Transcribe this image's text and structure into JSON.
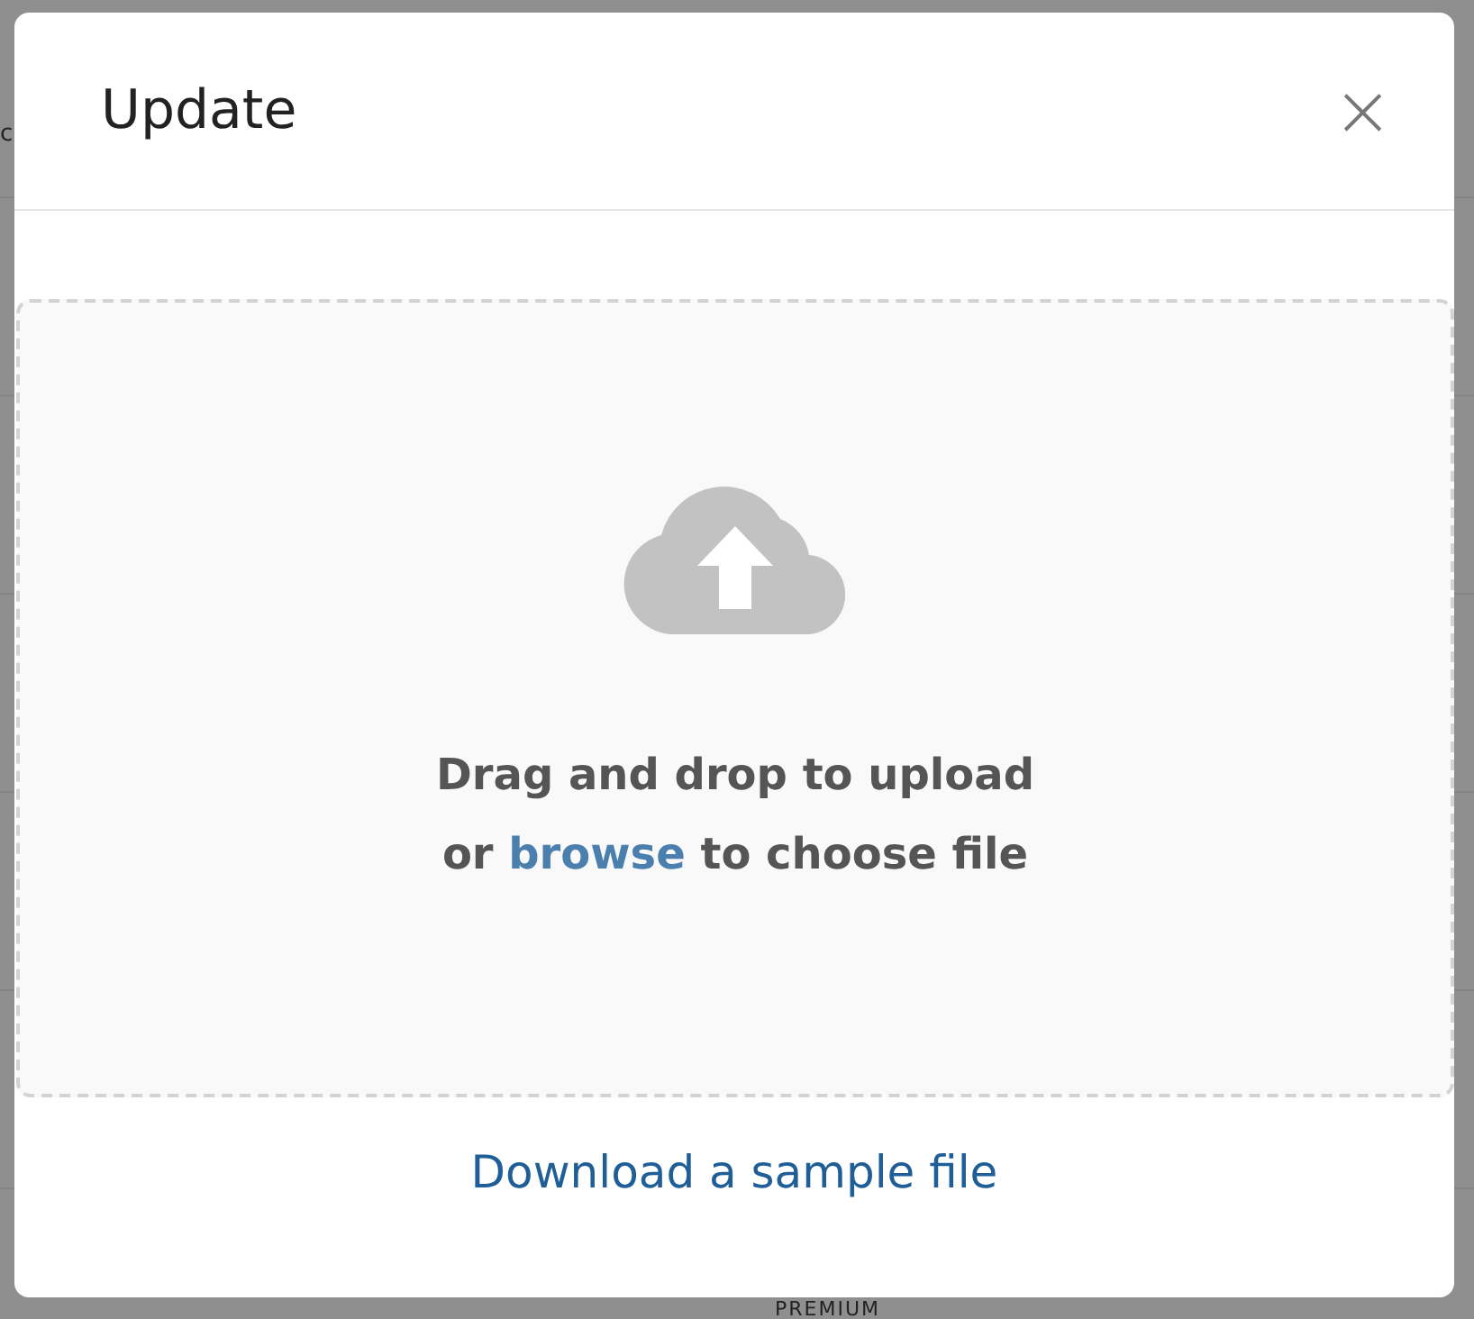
{
  "background": {
    "texts": [
      "c",
      "PREMIUM"
    ]
  },
  "dialog": {
    "title": "Update",
    "close": "×",
    "dropzone": {
      "line1": "Drag and drop to upload",
      "line2_before": "or",
      "link": "browse",
      "line2_after": "to choose file"
    },
    "sample_link": "Download a sample file"
  }
}
